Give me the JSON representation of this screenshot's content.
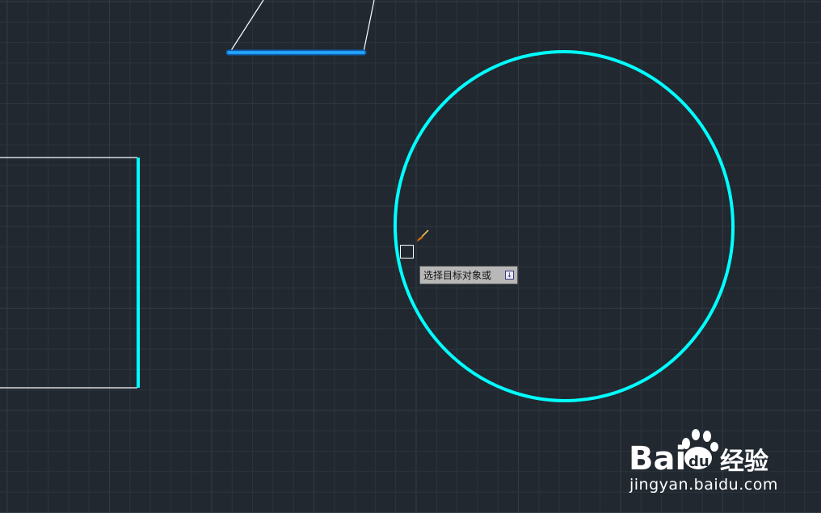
{
  "canvas": {
    "background": "#212830",
    "grid_color": "#2c343e",
    "grid_major_color": "#323b46",
    "highlight_color": "#00ffff",
    "selected_line_color": "#1e9cff",
    "line_color": "#ffffff"
  },
  "cursor": {
    "pick_box_icon": "square-pickbox-icon",
    "match_properties_icon": "paintbrush-icon"
  },
  "tooltip": {
    "prompt": "选择目标对象或",
    "menu_button_glyph": "↓",
    "menu_button_icon": "down-arrow-icon"
  },
  "watermark": {
    "logo_text": "Bai",
    "logo_paw_text": "du",
    "logo_suffix": "经验",
    "url": "jingyan.baidu.com"
  }
}
